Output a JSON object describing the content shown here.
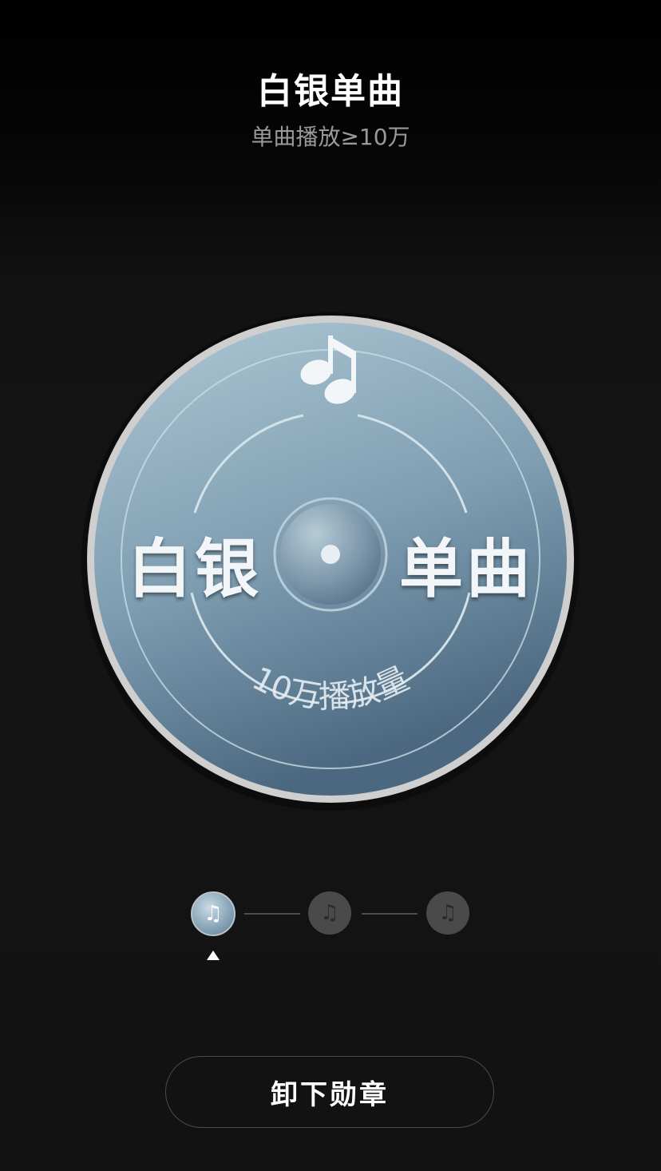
{
  "header": {
    "title": "白银单曲",
    "subtitle": "单曲播放≥10万"
  },
  "badge": {
    "left_text": "白银",
    "right_text": "单曲",
    "ring_text": "10万播放量",
    "icon": "music-note-icon",
    "tier": "silver",
    "colors": {
      "face_top": "#a9c3d0",
      "face_bottom": "#4d6a82",
      "rim": "#cfcfcf"
    }
  },
  "levels": {
    "items": [
      {
        "icon": "music-note-icon",
        "state": "active"
      },
      {
        "icon": "music-note-icon",
        "state": "inactive"
      },
      {
        "icon": "music-note-icon",
        "state": "inactive"
      }
    ],
    "selected_index": 0
  },
  "action": {
    "remove_label": "卸下勋章"
  }
}
